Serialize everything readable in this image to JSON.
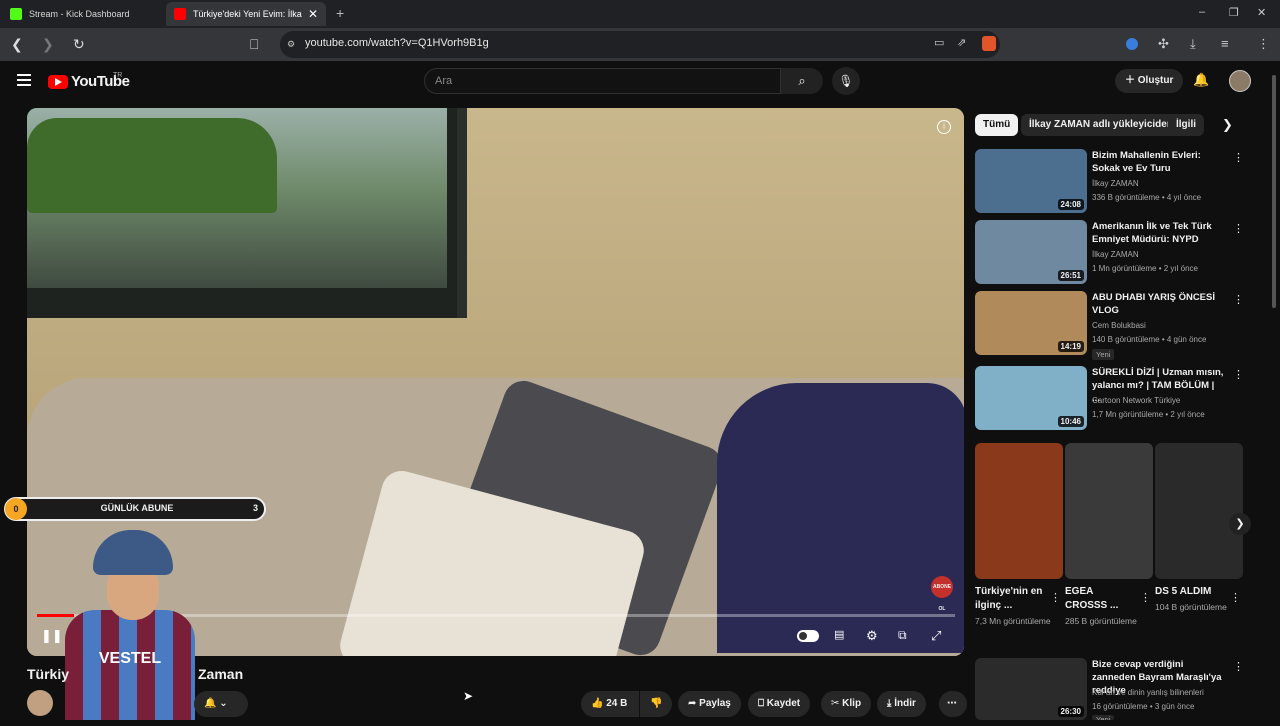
{
  "browser": {
    "tabs": [
      {
        "title": "Stream - Kick Dashboard",
        "color": "#53fc18"
      },
      {
        "title": "Türkiye'deki Yeni Evim: İlkay",
        "color": "#ff0000"
      }
    ],
    "new_tab": "+",
    "url": "youtube.com/watch?v=Q1HVorh9B1g",
    "window_controls": [
      "–",
      "❐",
      "✕"
    ]
  },
  "youtube": {
    "logo_text": "YouTube",
    "country": "TR",
    "search_placeholder": "Ara",
    "create_label": "Oluştur"
  },
  "player": {
    "overlay_label": "GÜNLÜK ABUNE",
    "overlay_left": "0",
    "overlay_count": "3",
    "shirt_text": "VESTEL",
    "subscribe_badge": "ABONE OL",
    "progress_fraction": 0.04
  },
  "video": {
    "title_start": "Türkiy",
    "title_end": "Zaman",
    "likes": "24 B",
    "actions": {
      "share": "Paylaş",
      "save": "Kaydet",
      "clip": "Klip",
      "download": "İndir"
    }
  },
  "sidebar": {
    "chips": [
      "Tümü",
      "İlkay ZAMAN adlı yükleyiciden",
      "İlgili"
    ],
    "recommended": [
      {
        "title": "Bizim Mahallenin Evleri: Sokak ve Ev Turu",
        "channel": "İlkay ZAMAN",
        "meta": "336 B görüntüleme • 4 yıl önce",
        "duration": "24:08",
        "color": "#4d6f8f"
      },
      {
        "title": "Amerikanın İlk ve Tek Türk Emniyet Müdürü: NYPD",
        "channel": "İlkay ZAMAN",
        "meta": "1 Mn görüntüleme • 2 yıl önce",
        "duration": "26:51",
        "color": "#6f8aa0"
      },
      {
        "title": "ABU DHABI YARIŞ ÖNCESİ VLOG",
        "channel": "Cem Bolukbasi",
        "meta": "140 B görüntüleme • 4 gün önce",
        "duration": "14:19",
        "badge": "Yeni",
        "color": "#b08a5a"
      },
      {
        "title": "SÜREKLİ DİZİ | Uzman mısın, yalancı mı? | TAM BÖLÜM | ...",
        "channel": "Cartoon Network Türkiye",
        "meta": "1,7 Mn görüntüleme • 2 yıl önce",
        "duration": "10:46",
        "color": "#7fb0c8"
      }
    ],
    "shorts": [
      {
        "title": "Türkiye'nin en ilginç ...",
        "views": "7,3 Mn görüntüleme",
        "color": "#8a3a1a"
      },
      {
        "title": "EGEA CROSSS ...",
        "views": "285 B görüntüleme",
        "color": "#3a3a3a"
      },
      {
        "title": "DS 5 ALDIM",
        "views": "104 B görüntüleme",
        "color": "#2a2a2a"
      }
    ],
    "last": {
      "title": "Bize cevap verdiğini zanneden Bayram Maraşlı'ya reddiye",
      "channel": "Kur'an ve dinin yanlış bilinenleri",
      "meta": "16 görüntüleme • 3 gün önce",
      "duration": "26:30",
      "badge": "Yeni",
      "color": "#2b2b2b"
    }
  }
}
